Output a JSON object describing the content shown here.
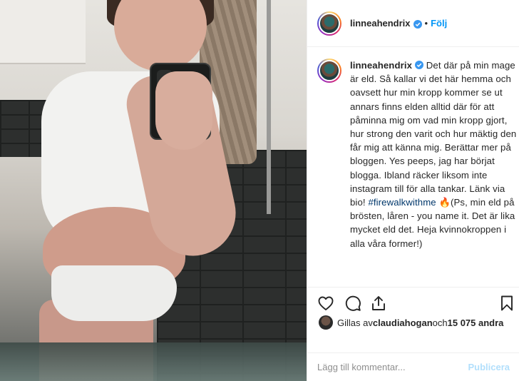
{
  "post": {
    "username": "linneahendrix",
    "follow_label": "Följ",
    "separator": "•"
  },
  "caption": {
    "username": "linneahendrix",
    "text_part1": " Det där på min mage är eld. Så kallar vi det här hemma och oavsett hur min kropp kommer se ut annars finns elden alltid där för att påminna mig om vad min kropp gjort, hur strong den varit och hur mäktig den får mig att känna mig. Berättar mer på bloggen. Yes peeps, jag har börjat blogga. Ibland räcker liksom inte instagram till för alla tankar. Länk via bio! ",
    "hashtag": "#firewalkwithme",
    "emoji": "🔥",
    "text_part2": "(Ps, min eld på brösten, låren - you name it. Det är lika mycket eld det. Heja kvinnokroppen i alla våra former!)"
  },
  "likes": {
    "prefix": "Gillas av ",
    "user": "claudiahogan",
    "middle": " och ",
    "count": "15 075 andra"
  },
  "comment": {
    "placeholder": "Lägg till kommentar...",
    "post_label": "Publicera"
  },
  "icons": {
    "like": "heart-icon",
    "comment": "comment-icon",
    "share": "share-icon",
    "save": "bookmark-icon",
    "verified": "verified-badge-icon"
  },
  "colors": {
    "accent": "#0095f6",
    "hashtag": "#00376b",
    "post_disabled": "#b2dffc",
    "text": "#262626",
    "muted": "#8e8e8e"
  }
}
